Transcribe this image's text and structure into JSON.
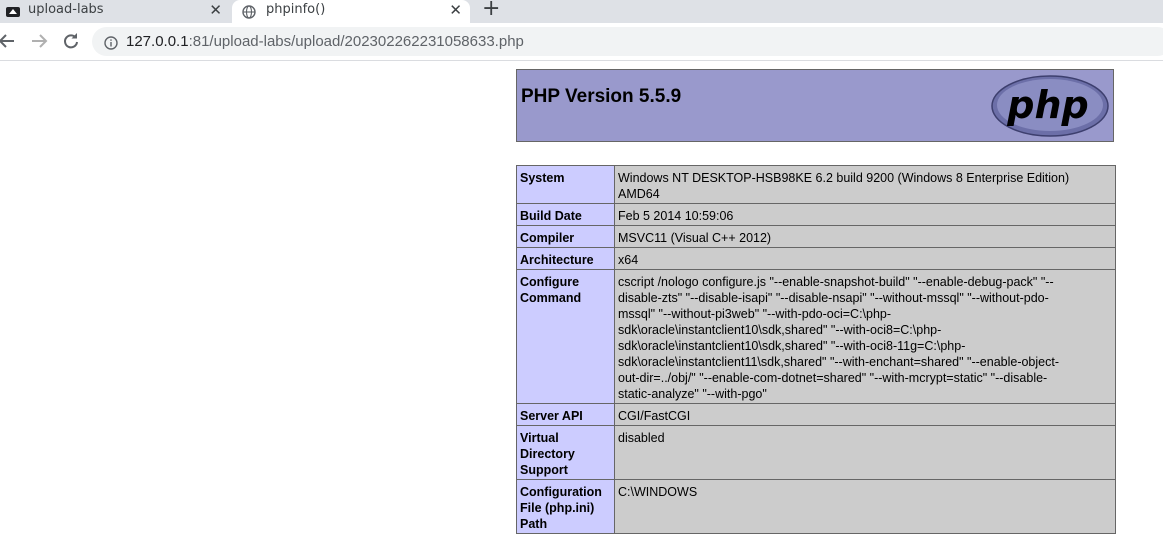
{
  "tabs": [
    {
      "title": "upload-labs",
      "active": false
    },
    {
      "title": "phpinfo()",
      "active": true
    }
  ],
  "address_bar": {
    "host": "127.0.0.1",
    "path": ":81/upload-labs/upload/202302262231058633.php"
  },
  "page": {
    "title": "PHP Version 5.5.9",
    "logo_text": "php",
    "rows": [
      {
        "label": "System",
        "value_lines": [
          "Windows NT DESKTOP-HSB98KE 6.2 build 9200 (Windows 8 Enterprise Edition)",
          "AMD64"
        ]
      },
      {
        "label": "Build Date",
        "value_lines": [
          "Feb 5 2014 10:59:06"
        ]
      },
      {
        "label": "Compiler",
        "value_lines": [
          "MSVC11 (Visual C++ 2012)"
        ]
      },
      {
        "label": "Architecture",
        "value_lines": [
          "x64"
        ]
      },
      {
        "label": "Configure Command",
        "value_lines": [
          "cscript /nologo configure.js \"--enable-snapshot-build\" \"--enable-debug-pack\" \"--",
          "disable-zts\" \"--disable-isapi\" \"--disable-nsapi\" \"--without-mssql\" \"--without-pdo-",
          "mssql\" \"--without-pi3web\" \"--with-pdo-oci=C:\\php-",
          "sdk\\oracle\\instantclient10\\sdk,shared\" \"--with-oci8=C:\\php-",
          "sdk\\oracle\\instantclient10\\sdk,shared\" \"--with-oci8-11g=C:\\php-",
          "sdk\\oracle\\instantclient11\\sdk,shared\" \"--with-enchant=shared\" \"--enable-object-",
          "out-dir=../obj/\" \"--enable-com-dotnet=shared\" \"--with-mcrypt=static\" \"--disable-",
          "static-analyze\" \"--with-pgo\""
        ]
      },
      {
        "label": "Server API",
        "value_lines": [
          "CGI/FastCGI"
        ]
      },
      {
        "label": "Virtual Directory Support",
        "value_lines": [
          "disabled"
        ]
      },
      {
        "label": "Configuration File (php.ini) Path",
        "value_lines": [
          "C:\\WINDOWS"
        ]
      }
    ]
  },
  "colors": {
    "header_bg": "#9999cc",
    "label_bg": "#ccccff",
    "value_bg": "#cccccc",
    "tabstrip_bg": "#dee1e6"
  }
}
